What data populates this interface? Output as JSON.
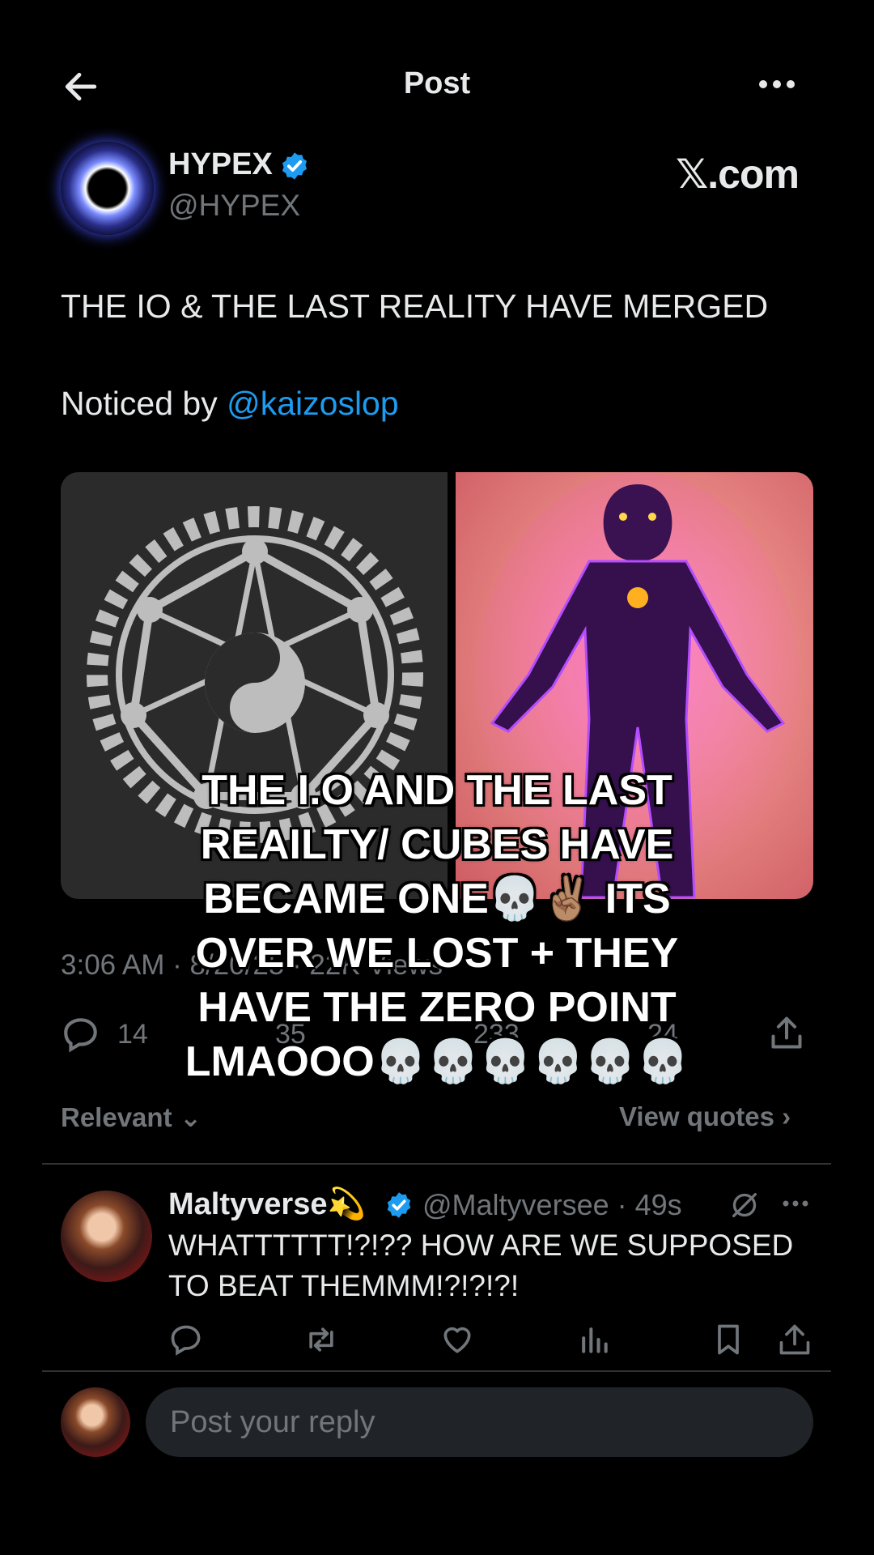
{
  "header": {
    "title": "Post"
  },
  "author": {
    "name": "HYPEX",
    "handle": "@HYPEX"
  },
  "watermark": "𝕏.com",
  "post": {
    "line1": "THE IO & THE LAST REALITY HAVE MERGED",
    "line2_prefix": "Noticed by ",
    "mention": "@kaizoslop",
    "timestamp": "3:06 AM · 8/20/25 · 22K Views"
  },
  "stats": {
    "replies": "14",
    "reposts": "35",
    "likes": "233",
    "bookmarks": "24"
  },
  "filters": {
    "sort": "Relevant",
    "quotes": "View quotes"
  },
  "reply": {
    "name": "Maltyverse💫",
    "handle_time": "@Maltyversee · 49s",
    "line1": "WHATTTTTT!?!?? HOW ARE WE SUPPOSED",
    "line2": "TO BEAT THEMMM!?!?!?!"
  },
  "compose": {
    "placeholder": "Post your reply"
  },
  "caption": {
    "lines": [
      "THE I.O AND THE LAST",
      "REAILTY/ CUBES HAVE",
      "BECAME ONE💀✌🏽 ITS",
      "OVER WE LOST + THEY",
      "HAVE THE ZERO POINT",
      "LMAOOO💀💀💀💀💀💀"
    ]
  },
  "colors": {
    "accent": "#1d9bf0",
    "muted": "#71767b",
    "text": "#e7e9ea",
    "background": "#000000"
  },
  "icons": [
    "back-arrow-icon",
    "more-icon",
    "verified-icon",
    "reply-icon",
    "repost-icon",
    "like-icon",
    "views-icon",
    "bookmark-icon",
    "share-icon",
    "chevron-down-icon",
    "chevron-right-icon",
    "grok-icon"
  ]
}
